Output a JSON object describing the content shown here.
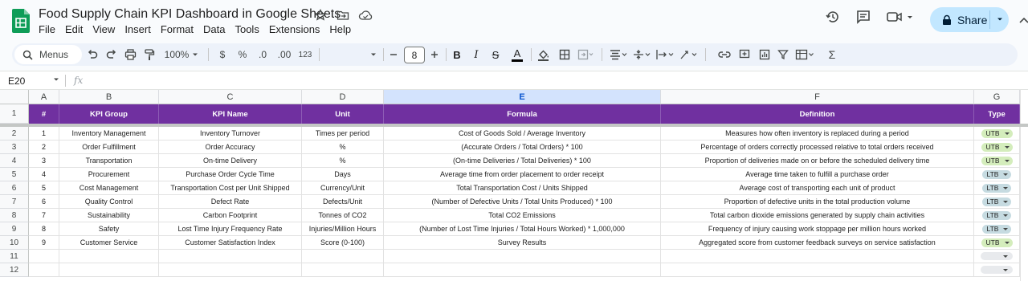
{
  "document": {
    "title": "Food Supply Chain KPI Dashboard in Google Sheets",
    "share_label": "Share"
  },
  "menu": [
    "File",
    "Edit",
    "View",
    "Insert",
    "Format",
    "Data",
    "Tools",
    "Extensions",
    "Help"
  ],
  "toolbar": {
    "search_label": "Menus",
    "zoom": "100%",
    "currency": "$",
    "percent": "%",
    "decrease_decimal": ".0",
    "increase_decimal": ".00",
    "number_format": "123",
    "font_size": "8"
  },
  "formula_bar": {
    "name_box": "E20",
    "fx": "fx"
  },
  "columns": [
    "A",
    "B",
    "C",
    "D",
    "E",
    "F",
    "G"
  ],
  "selected_column": "E",
  "header_row": [
    "#",
    "KPI Group",
    "KPI Name",
    "Unit",
    "Formula",
    "Definition",
    "Type"
  ],
  "rows": [
    [
      "1",
      "Inventory Management",
      "Inventory Turnover",
      "Times per period",
      "Cost of Goods Sold / Average Inventory",
      "Measures how often inventory is replaced during a period",
      "UTB"
    ],
    [
      "2",
      "Order Fulfillment",
      "Order Accuracy",
      "%",
      "(Accurate Orders / Total Orders) * 100",
      "Percentage of orders correctly processed relative to total orders received",
      "UTB"
    ],
    [
      "3",
      "Transportation",
      "On-time Delivery",
      "%",
      "(On-time Deliveries / Total Deliveries) * 100",
      "Proportion of deliveries made on or before the scheduled delivery time",
      "UTB"
    ],
    [
      "4",
      "Procurement",
      "Purchase Order Cycle Time",
      "Days",
      "Average time from order placement to order receipt",
      "Average time taken to fulfill a purchase order",
      "LTB"
    ],
    [
      "5",
      "Cost Management",
      "Transportation Cost per Unit Shipped",
      "Currency/Unit",
      "Total Transportation Cost / Units Shipped",
      "Average cost of transporting each unit of product",
      "LTB"
    ],
    [
      "6",
      "Quality Control",
      "Defect Rate",
      "Defects/Unit",
      "(Number of Defective Units / Total Units Produced) * 100",
      "Proportion of defective units in the total production volume",
      "LTB"
    ],
    [
      "7",
      "Sustainability",
      "Carbon Footprint",
      "Tonnes of CO2",
      "Total CO2 Emissions",
      "Total carbon dioxide emissions generated by supply chain activities",
      "LTB"
    ],
    [
      "8",
      "Safety",
      "Lost Time Injury Frequency Rate",
      "Injuries/Million Hours",
      "(Number of Lost Time Injuries / Total Hours Worked) * 1,000,000",
      "Frequency of injury causing work stoppage per million hours worked",
      "LTB"
    ],
    [
      "9",
      "Customer Service",
      "Customer Satisfaction Index",
      "Score (0-100)",
      "Survey Results",
      "Aggregated score from customer feedback surveys on service satisfaction",
      "UTB"
    ]
  ],
  "row_numbers": [
    "1",
    "2",
    "3",
    "4",
    "5",
    "6",
    "7",
    "8",
    "9",
    "10",
    "11",
    "12"
  ],
  "colors": {
    "header_bg": "#7030a0",
    "utb_chip": "#d4edbc",
    "ltb_chip": "#c6dbe1",
    "share_bg": "#c2e7ff"
  }
}
